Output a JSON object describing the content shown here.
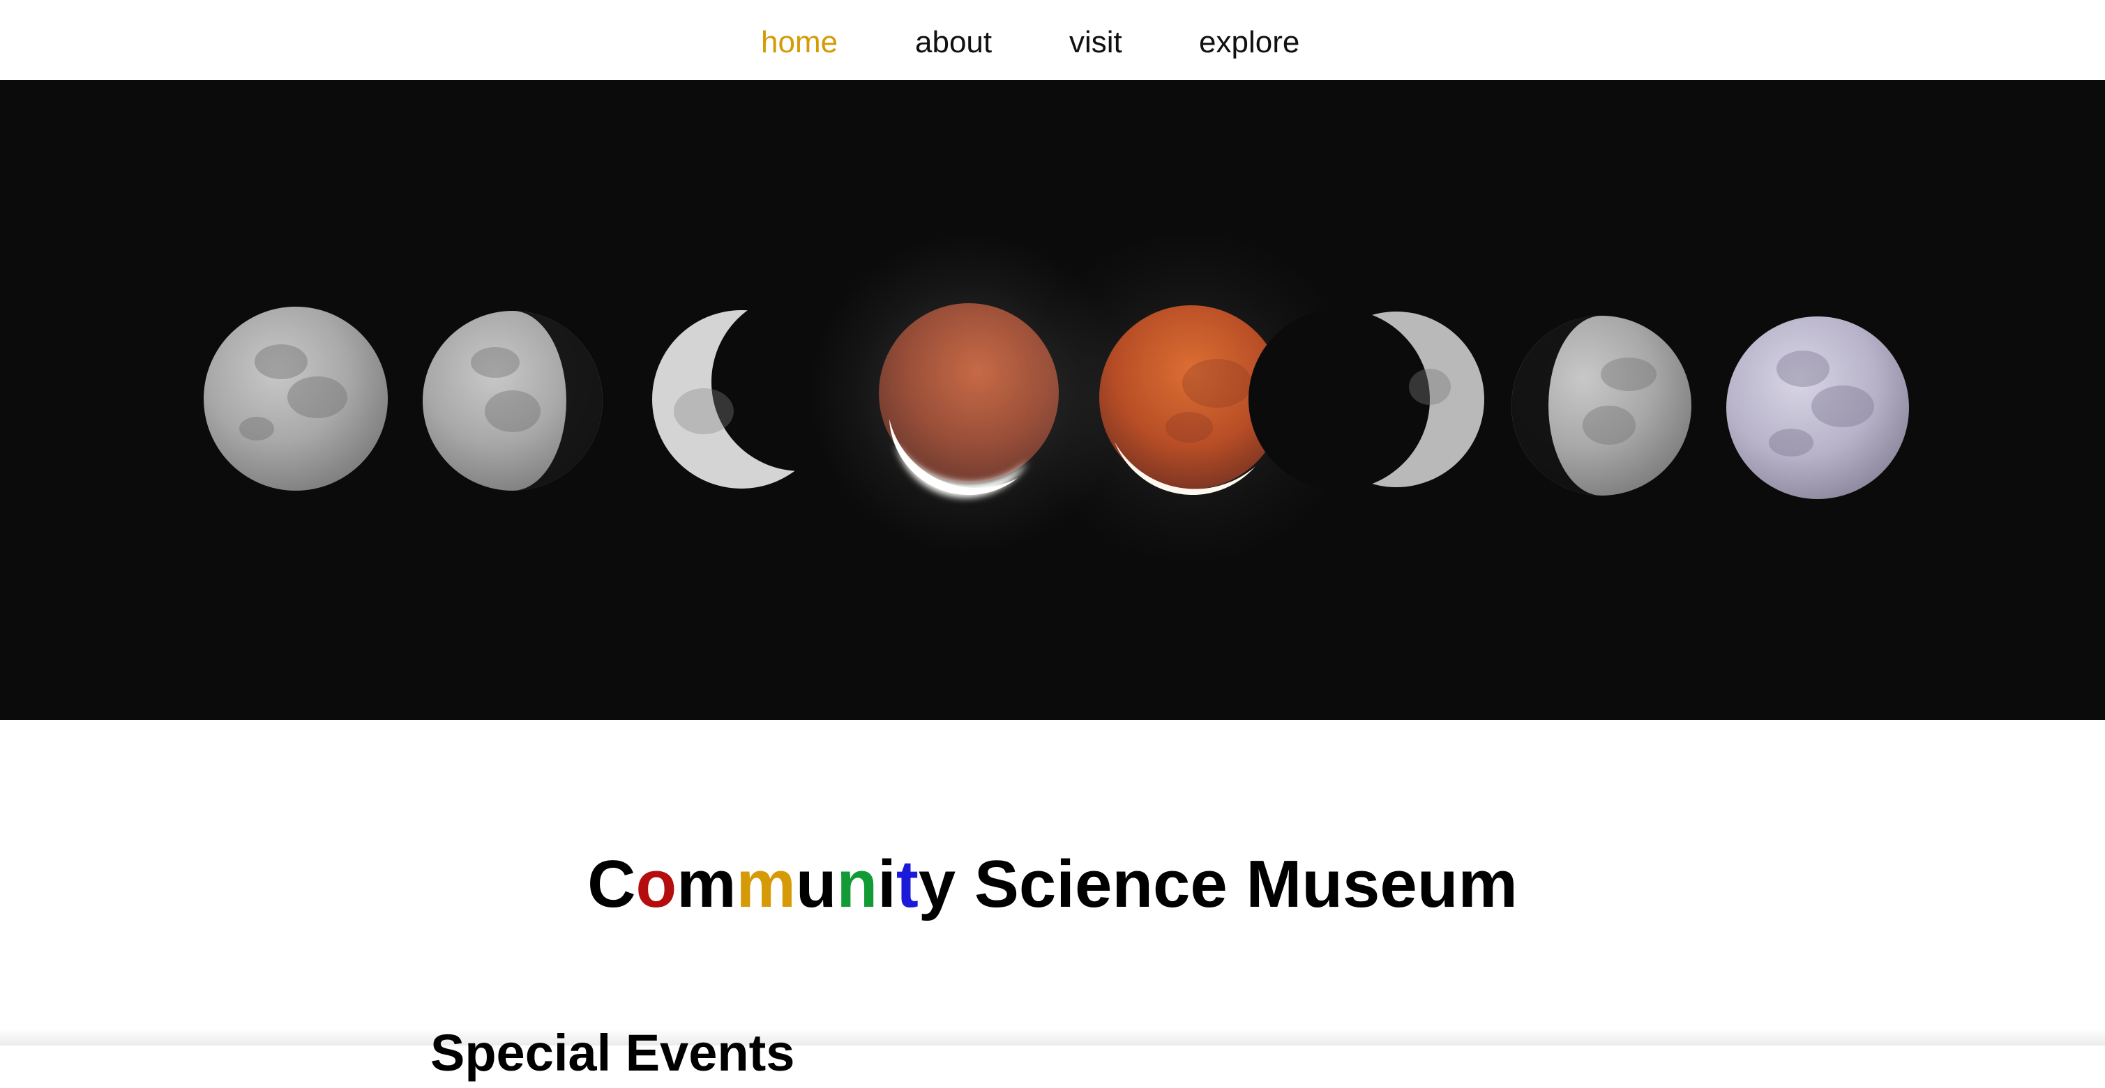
{
  "nav": {
    "items": [
      {
        "label": "home",
        "active": true
      },
      {
        "label": "about",
        "active": false
      },
      {
        "label": "visit",
        "active": false
      },
      {
        "label": "explore",
        "active": false
      }
    ],
    "active_color": "#d59a05"
  },
  "hero": {
    "image": "lunar-eclipse-phases-photo",
    "background_color": "#0b0b0b"
  },
  "title": {
    "text": "Community Science Museum",
    "letters": [
      {
        "char": "C",
        "color": "#000000"
      },
      {
        "char": "o",
        "color": "#b50d0d"
      },
      {
        "char": "m",
        "color": "#000000"
      },
      {
        "char": "m",
        "color": "#d59a05"
      },
      {
        "char": "u",
        "color": "#000000"
      },
      {
        "char": "n",
        "color": "#119a35"
      },
      {
        "char": "i",
        "color": "#000000"
      },
      {
        "char": "t",
        "color": "#1a1ad8"
      },
      {
        "char": "y",
        "color": "#000000"
      },
      {
        "char": " ",
        "color": "#000000"
      },
      {
        "char": "S",
        "color": "#000000"
      },
      {
        "char": "c",
        "color": "#000000"
      },
      {
        "char": "i",
        "color": "#000000"
      },
      {
        "char": "e",
        "color": "#000000"
      },
      {
        "char": "n",
        "color": "#000000"
      },
      {
        "char": "c",
        "color": "#000000"
      },
      {
        "char": "e",
        "color": "#000000"
      },
      {
        "char": " ",
        "color": "#000000"
      },
      {
        "char": "M",
        "color": "#000000"
      },
      {
        "char": "u",
        "color": "#000000"
      },
      {
        "char": "s",
        "color": "#000000"
      },
      {
        "char": "e",
        "color": "#000000"
      },
      {
        "char": "u",
        "color": "#000000"
      },
      {
        "char": "m",
        "color": "#000000"
      }
    ]
  },
  "section": {
    "heading": "Special Events"
  }
}
